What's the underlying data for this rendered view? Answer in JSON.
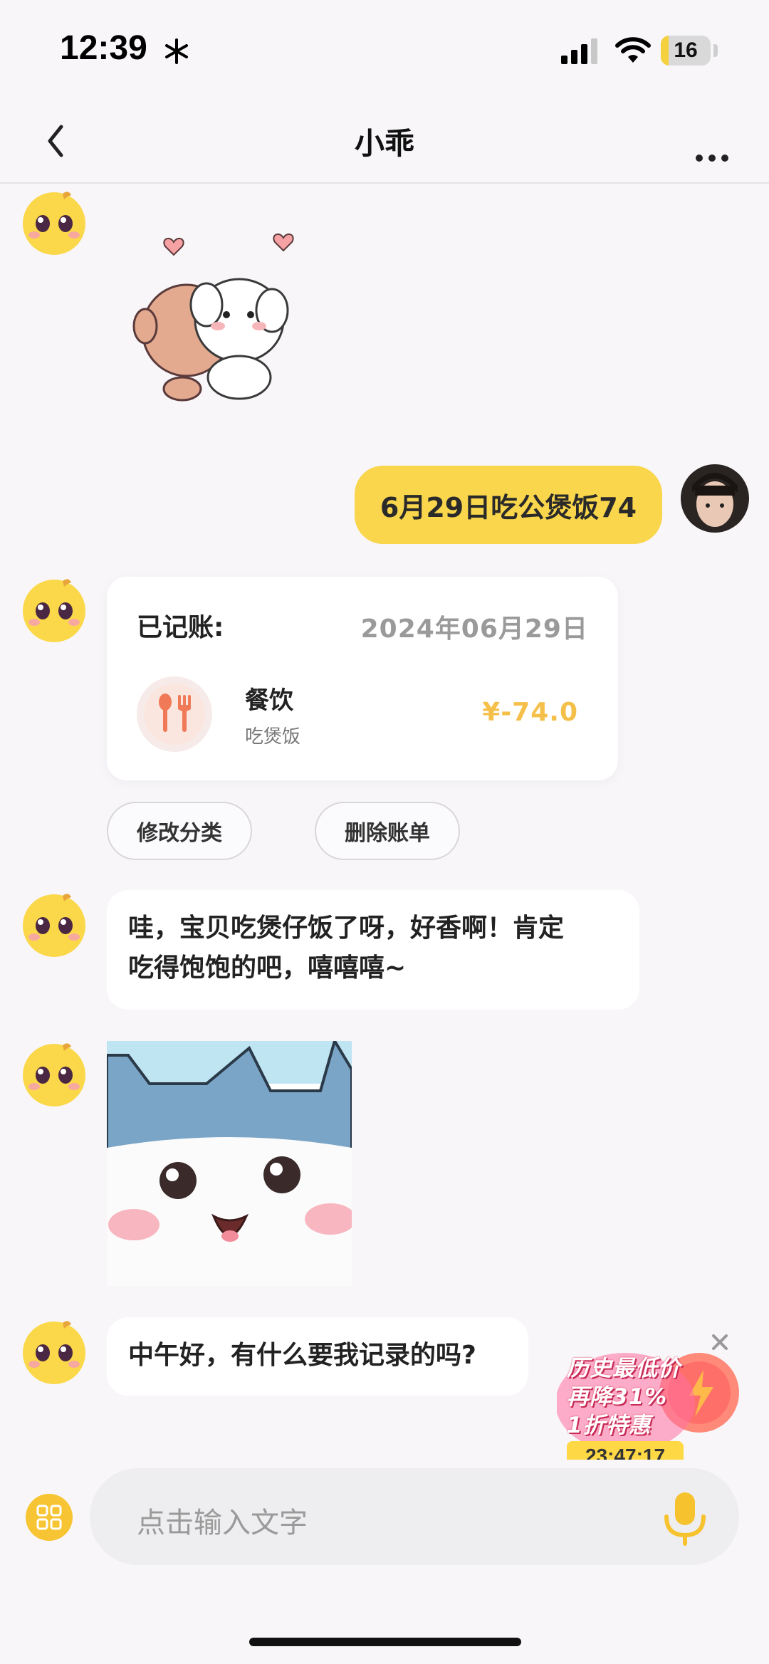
{
  "status_bar": {
    "time": "12:39",
    "battery_level": "16",
    "battery_fraction": 0.16,
    "icons": [
      "snowflake-icon",
      "signal-icon",
      "wifi-icon",
      "battery-icon"
    ]
  },
  "nav": {
    "title": "小乖",
    "back_icon": "chevron-left-icon",
    "more_icon": "more-dots-icon"
  },
  "messages": {
    "user_message": "6月29日吃公煲饭74",
    "bill": {
      "status": "已记账:",
      "date": "2024年06月29日",
      "category": "餐饮",
      "note": "吃煲饭",
      "amount": "¥-74.0",
      "icon": "fork-spoon-icon"
    },
    "actions": {
      "edit_category": "修改分类",
      "delete_bill": "删除账单"
    },
    "reply_1_line1": "哇，宝贝吃煲仔饭了呀，好香啊！肯定",
    "reply_1_line2": "吃得饱饱的吧，嘻嘻嘻~",
    "reply_2": "中午好，有什么要我记录的吗?"
  },
  "promo": {
    "line1": "历史最低价",
    "line2": "再降31%",
    "line3": "1折特惠",
    "timer": "23:47:17",
    "close_icon": "close-icon"
  },
  "input": {
    "placeholder": "点击输入文字",
    "apps_icon": "apps-grid-icon",
    "mic_icon": "microphone-icon"
  },
  "colors": {
    "accent_yellow": "#f9d64c",
    "amount_color": "#f5c04a",
    "background": "#f8f6f9"
  }
}
